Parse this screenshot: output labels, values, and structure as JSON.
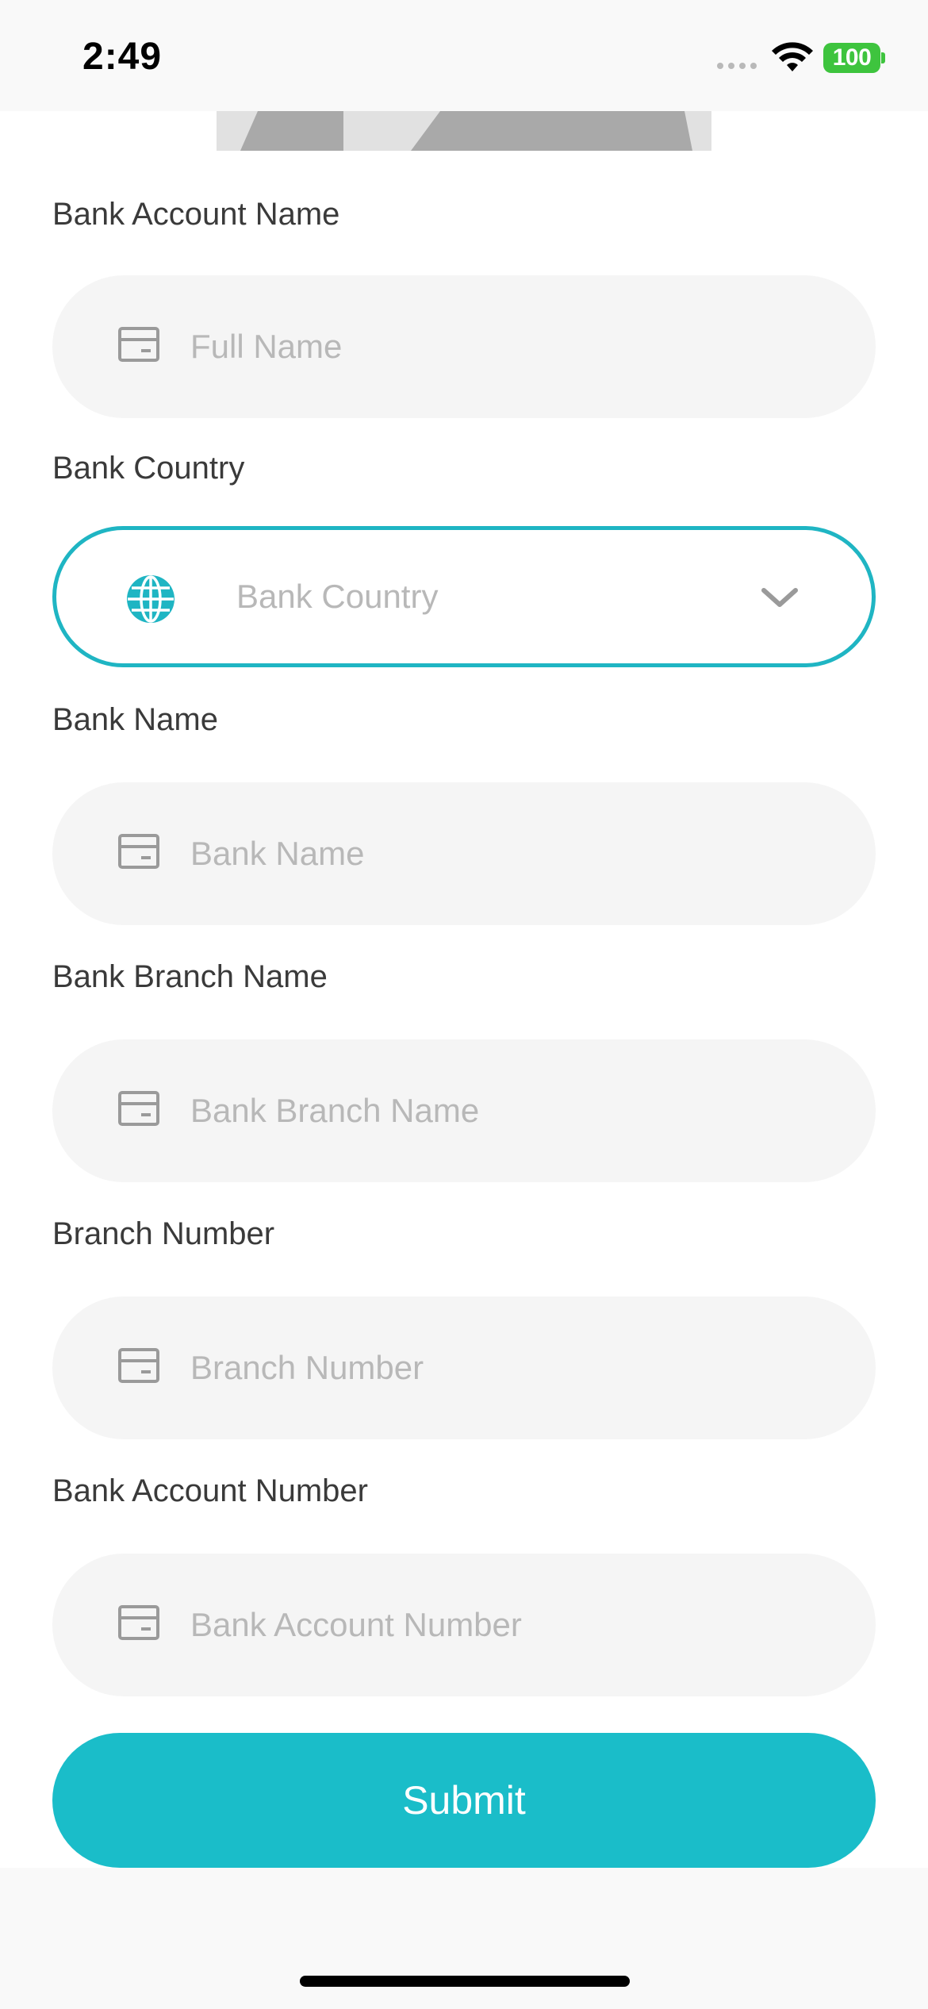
{
  "status_bar": {
    "time": "2:49",
    "battery_level": "100"
  },
  "form": {
    "fields": [
      {
        "label": "Bank Account Name",
        "placeholder": "Full Name",
        "icon": "card-icon"
      },
      {
        "label": "Bank Country",
        "placeholder": "Bank Country",
        "icon": "globe-icon",
        "type": "select",
        "focused": true
      },
      {
        "label": "Bank Name",
        "placeholder": "Bank Name",
        "icon": "card-icon"
      },
      {
        "label": "Bank Branch Name",
        "placeholder": "Bank Branch Name",
        "icon": "card-icon"
      },
      {
        "label": "Branch Number",
        "placeholder": "Branch Number",
        "icon": "card-icon"
      },
      {
        "label": "Bank Account Number",
        "placeholder": "Bank Account Number",
        "icon": "card-icon"
      }
    ],
    "submit_label": "Submit"
  },
  "colors": {
    "accent": "#1abdc9",
    "field_background": "#f5f5f5",
    "placeholder": "#b8b8b8",
    "label": "#3a3a3a",
    "battery": "#3ec43e"
  }
}
